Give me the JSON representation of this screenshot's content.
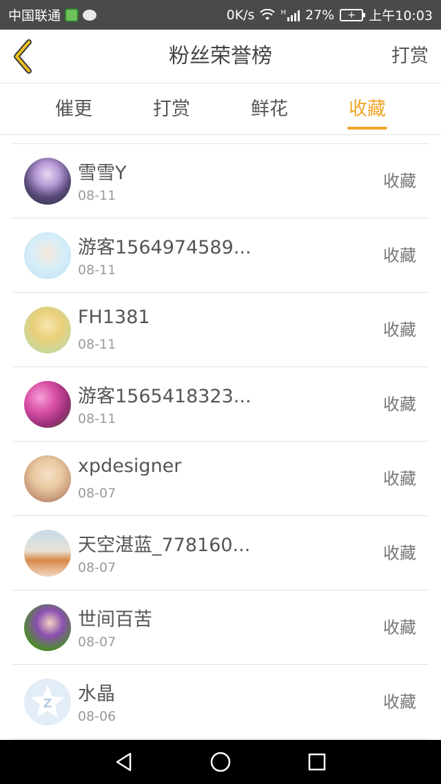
{
  "status_bar": {
    "carrier": "中国联通",
    "speed": "0K/s",
    "network": "H",
    "battery": "27%",
    "time": "上午10:03"
  },
  "header": {
    "title": "粉丝荣誉榜",
    "action_label": "打赏",
    "back_icon": "chevron-left-icon",
    "accent_color": "#f0a52a"
  },
  "tabs": [
    {
      "label": "催更",
      "active": false
    },
    {
      "label": "打赏",
      "active": false
    },
    {
      "label": "鲜花",
      "active": false
    },
    {
      "label": "收藏",
      "active": true
    }
  ],
  "list": {
    "items": [
      {
        "name": "雪雪Y",
        "date": "08-11",
        "action": "收藏",
        "avatar_icon": "anime-girl-avatar"
      },
      {
        "name": "游客1564974589...",
        "date": "08-11",
        "action": "收藏",
        "avatar_icon": "couple-illustration-avatar"
      },
      {
        "name": "FH1381",
        "date": "08-11",
        "action": "收藏",
        "avatar_icon": "blonde-girl-avatar"
      },
      {
        "name": "游客1565418323...",
        "date": "08-11",
        "action": "收藏",
        "avatar_icon": "pink-flowers-avatar"
      },
      {
        "name": "xpdesigner",
        "date": "08-07",
        "action": "收藏",
        "avatar_icon": "baby-avatar"
      },
      {
        "name": "天空湛蓝_778160...",
        "date": "08-07",
        "action": "收藏",
        "avatar_icon": "dogs-avatar"
      },
      {
        "name": "世间百苦",
        "date": "08-07",
        "action": "收藏",
        "avatar_icon": "purple-hair-girl-avatar"
      },
      {
        "name": "水晶",
        "date": "08-06",
        "action": "收藏",
        "avatar_icon": "qq-star-avatar"
      }
    ]
  },
  "nav_bar": {
    "back_icon": "triangle-back-icon",
    "home_icon": "circle-home-icon",
    "recents_icon": "square-recents-icon"
  }
}
